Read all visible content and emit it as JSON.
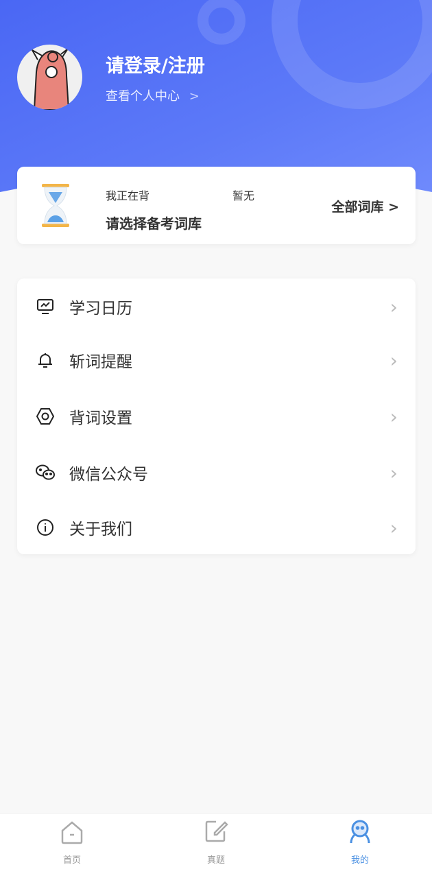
{
  "header": {
    "title": "请登录/注册",
    "subtitle": "查看个人中心",
    "subtitle_chevron": ">"
  },
  "book": {
    "studying_label": "我正在背",
    "studying_value": "暂无",
    "prompt": "请选择备考词库",
    "all_books": "全部词库 >"
  },
  "menu": [
    {
      "label": "学习日历",
      "icon": "calendar-chart-icon"
    },
    {
      "label": "斩词提醒",
      "icon": "bell-icon"
    },
    {
      "label": "背词设置",
      "icon": "settings-hex-icon"
    },
    {
      "label": "微信公众号",
      "icon": "wechat-icon"
    },
    {
      "label": "关于我们",
      "icon": "info-icon"
    }
  ],
  "tabs": [
    {
      "label": "首页",
      "icon": "home-icon"
    },
    {
      "label": "真题",
      "icon": "edit-icon"
    },
    {
      "label": "我的",
      "icon": "profile-icon",
      "active": true
    }
  ],
  "colors": {
    "accent": "#4a67f4",
    "tab_active": "#4a90e2"
  }
}
